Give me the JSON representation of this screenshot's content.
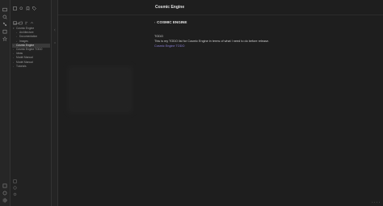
{
  "ribbon": {
    "top_icons": [
      "file-explorer-icon",
      "search-icon",
      "graph-icon",
      "calendar-icon",
      "star-icon"
    ],
    "bottom_icons": [
      "vault-icon",
      "help-icon",
      "settings-icon"
    ]
  },
  "sidebar": {
    "header_icons": [
      "files-icon",
      "search-icon",
      "bookmark-icon",
      "tag-icon"
    ],
    "tool_icons": [
      "new-note-icon",
      "new-folder-icon",
      "sort-icon",
      "collapse-icon"
    ],
    "vault_name": "Vaults",
    "tree": [
      {
        "label": "Cosmic Engine",
        "level": 0,
        "expanded": true,
        "active": false
      },
      {
        "label": "Architecture",
        "level": 1,
        "expanded": false,
        "active": false
      },
      {
        "label": "Documentation",
        "level": 1,
        "expanded": false,
        "active": false
      },
      {
        "label": "Images",
        "level": 1,
        "expanded": false,
        "active": false
      },
      {
        "label": "Cosmic Engine",
        "level": 0,
        "expanded": false,
        "active": true
      },
      {
        "label": "Cosmic Engine TODO",
        "level": 0,
        "expanded": false,
        "active": false
      },
      {
        "label": "Ideas",
        "level": 0,
        "expanded": false,
        "active": false
      },
      {
        "label": "Model Manual",
        "level": 0,
        "expanded": false,
        "active": false
      },
      {
        "label": "Model Manual",
        "level": 0,
        "expanded": false,
        "active": false
      },
      {
        "label": "Tutorials",
        "level": 0,
        "expanded": false,
        "active": false
      }
    ]
  },
  "editor": {
    "title": "Cosmic Engine",
    "heading": "COSMIC ENGINE",
    "line1": "TODO",
    "line2": "This is my TODO list for Cosmic Engine in terms of what I need to do before release.",
    "link": "Cosmic Engine TODO"
  },
  "status": {
    "items": [
      "",
      "",
      "",
      ""
    ]
  },
  "colors": {
    "accent": "#8a7fd6",
    "background": "#1e1e1e",
    "sidebar": "#222222"
  }
}
